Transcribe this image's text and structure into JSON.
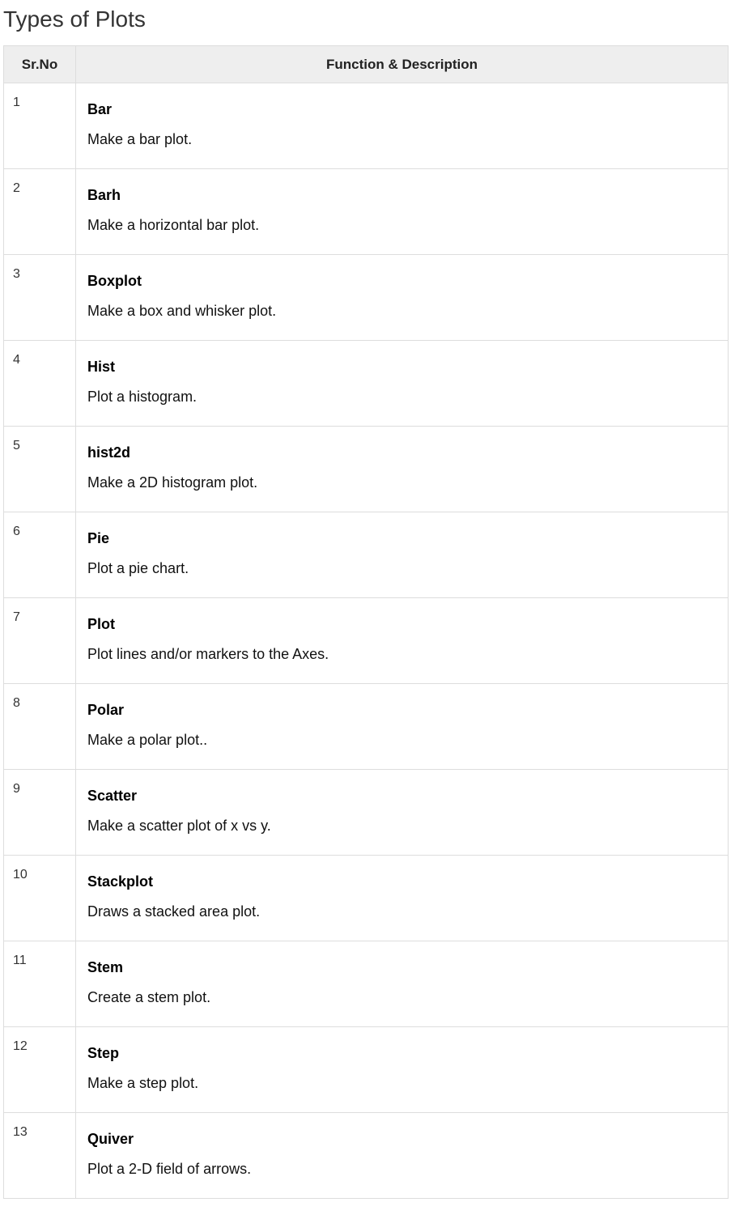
{
  "title": "Types of Plots",
  "table": {
    "headers": {
      "number": "Sr.No",
      "description": "Function & Description"
    },
    "rows": [
      {
        "number": "1",
        "name": "Bar",
        "description": "Make a bar plot."
      },
      {
        "number": "2",
        "name": "Barh",
        "description": "Make a horizontal bar plot."
      },
      {
        "number": "3",
        "name": "Boxplot",
        "description": "Make a box and whisker plot."
      },
      {
        "number": "4",
        "name": "Hist",
        "description": "Plot a histogram."
      },
      {
        "number": "5",
        "name": "hist2d",
        "description": "Make a 2D histogram plot."
      },
      {
        "number": "6",
        "name": "Pie",
        "description": "Plot a pie chart."
      },
      {
        "number": "7",
        "name": "Plot",
        "description": "Plot lines and/or markers to the Axes."
      },
      {
        "number": "8",
        "name": "Polar",
        "description": "Make a polar plot.."
      },
      {
        "number": "9",
        "name": "Scatter",
        "description": "Make a scatter plot of x vs y."
      },
      {
        "number": "10",
        "name": "Stackplot",
        "description": "Draws a stacked area plot."
      },
      {
        "number": "11",
        "name": "Stem",
        "description": "Create a stem plot."
      },
      {
        "number": "12",
        "name": "Step",
        "description": "Make a step plot."
      },
      {
        "number": "13",
        "name": "Quiver",
        "description": "Plot a 2-D field of arrows."
      }
    ]
  }
}
